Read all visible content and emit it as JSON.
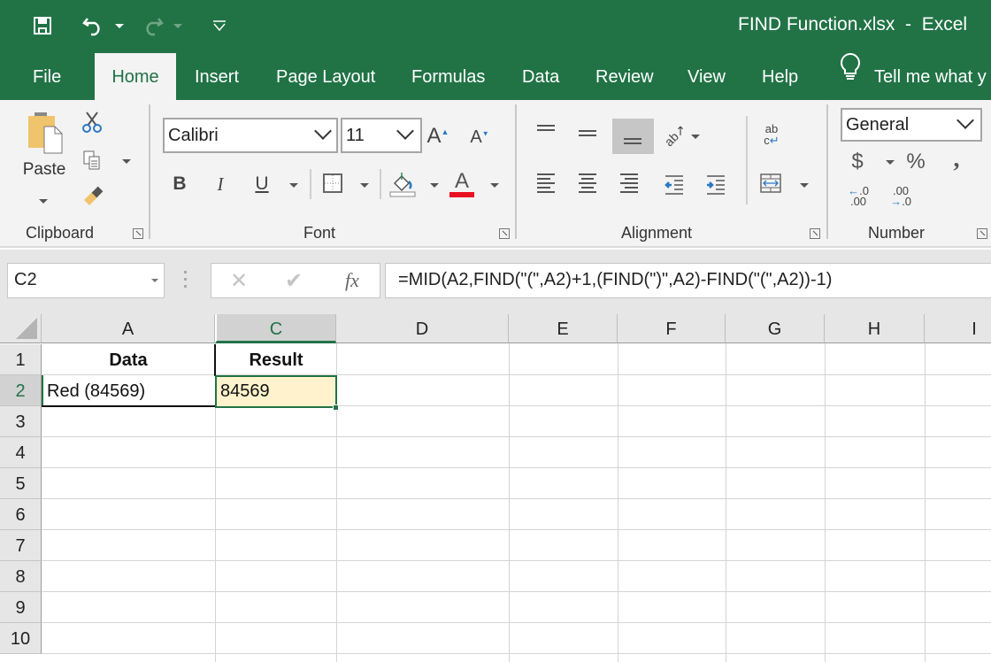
{
  "titlebar": {
    "title": "FIND Function.xlsx  -  Excel",
    "qat": [
      "save-icon",
      "undo-icon",
      "undo-dropdown",
      "redo-icon",
      "redo-dropdown",
      "customize-qat-icon"
    ]
  },
  "tabs": [
    {
      "label": "File",
      "active": false
    },
    {
      "label": "Home",
      "active": true
    },
    {
      "label": "Insert",
      "active": false
    },
    {
      "label": "Page Layout",
      "active": false
    },
    {
      "label": "Formulas",
      "active": false
    },
    {
      "label": "Data",
      "active": false
    },
    {
      "label": "Review",
      "active": false
    },
    {
      "label": "View",
      "active": false
    },
    {
      "label": "Help",
      "active": false
    }
  ],
  "tell_me": "Tell me what you want to do",
  "tell_me_visible": "Tell me what y",
  "ribbon": {
    "clipboard": {
      "label": "Clipboard",
      "paste": "Paste"
    },
    "font": {
      "label": "Font",
      "font_name": "Calibri",
      "font_size": "11",
      "bold": "B",
      "italic": "I",
      "underline": "U",
      "font_color": "#e81123"
    },
    "alignment": {
      "label": "Alignment"
    },
    "number": {
      "label": "Number",
      "format": "General",
      "currency": "$",
      "percent": "%",
      "comma": ",",
      "inc_decimal_top": ".0",
      "inc_decimal_bottom": ".00",
      "dec_decimal_top": ".00",
      "dec_decimal_bottom": ".0"
    },
    "wrap_text": {
      "top": "ab",
      "bottom": "c"
    }
  },
  "formula_bar": {
    "name_box": "C2",
    "fx": "fx",
    "formula": "=MID(A2,FIND(\"(\",A2)+1,(FIND(\")\",A2)-FIND(\"(\",A2))-1)"
  },
  "sheet": {
    "columns": [
      "A",
      "C",
      "D",
      "E",
      "F",
      "G",
      "H",
      "I"
    ],
    "rows": [
      "1",
      "2",
      "3",
      "4",
      "5",
      "6",
      "7",
      "8",
      "9",
      "10"
    ],
    "selected_cell": "C2",
    "cells": {
      "A1": "Data",
      "C1": "Result",
      "A2": "Red (84569)",
      "C2": "84569"
    },
    "colors": {
      "accent": "#217346",
      "selected_fill": "#fff2cc"
    }
  }
}
